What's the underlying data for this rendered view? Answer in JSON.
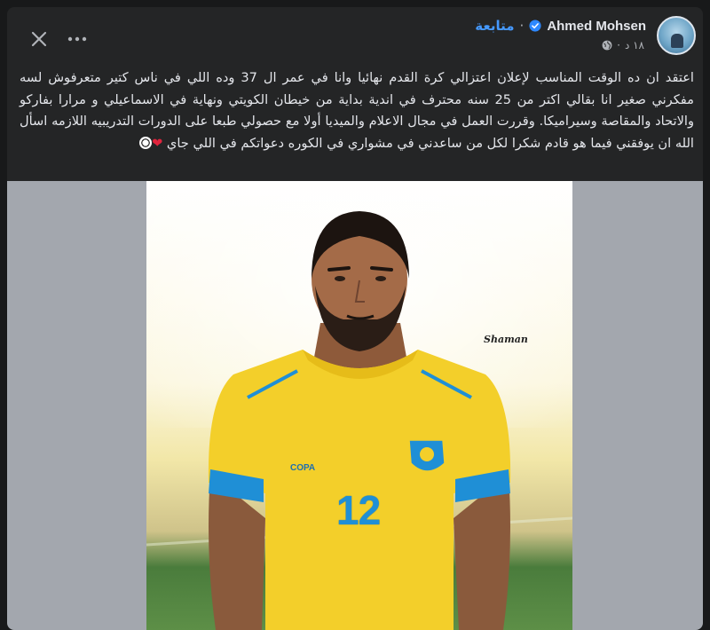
{
  "post": {
    "author": "Ahmed Mohsen",
    "follow_label": "متابعة",
    "dot": "·",
    "time": "١٨ د",
    "time_dot": "·",
    "text_main": "اعتقد ان ده الوقت المناسب لإعلان اعتزالي كرة القدم نهائيا وانا في عمر ال 37 وده اللي في ناس كتير متعرفوش لسه مفكرني صغير انا بقالي اكتر من 25 سنه محترف في اندية بداية من خيطان الكويتي ونهاية في الاسماعيلي و مرارا بفاركو والاتحاد والمقاصة وسيراميكا. وقررت العمل في مجال الاعلام والميديا أولا مع حصولي طبعا على الدورات التدريبيه اللازمه اسأل الله ان يوفقني فيما هو قادم شكرا لكل من ساعدني في مشواري في الكوره دعواتكم في اللي جاي ",
    "heart_emoji": "❤",
    "photo": {
      "watermark": "Shaman",
      "jersey_number": "12",
      "brand": "COPA"
    }
  },
  "icons": {
    "close": "close-icon",
    "more": "more-options-icon",
    "verified": "verified-badge-icon",
    "privacy": "globe-icon"
  },
  "colors": {
    "background": "#18191a",
    "card": "#242526",
    "text": "#e4e6eb",
    "link": "#4599ff",
    "verified": "#2d88ff",
    "jersey": "#f3cf2a",
    "jersey_trim": "#1f8fd6"
  }
}
